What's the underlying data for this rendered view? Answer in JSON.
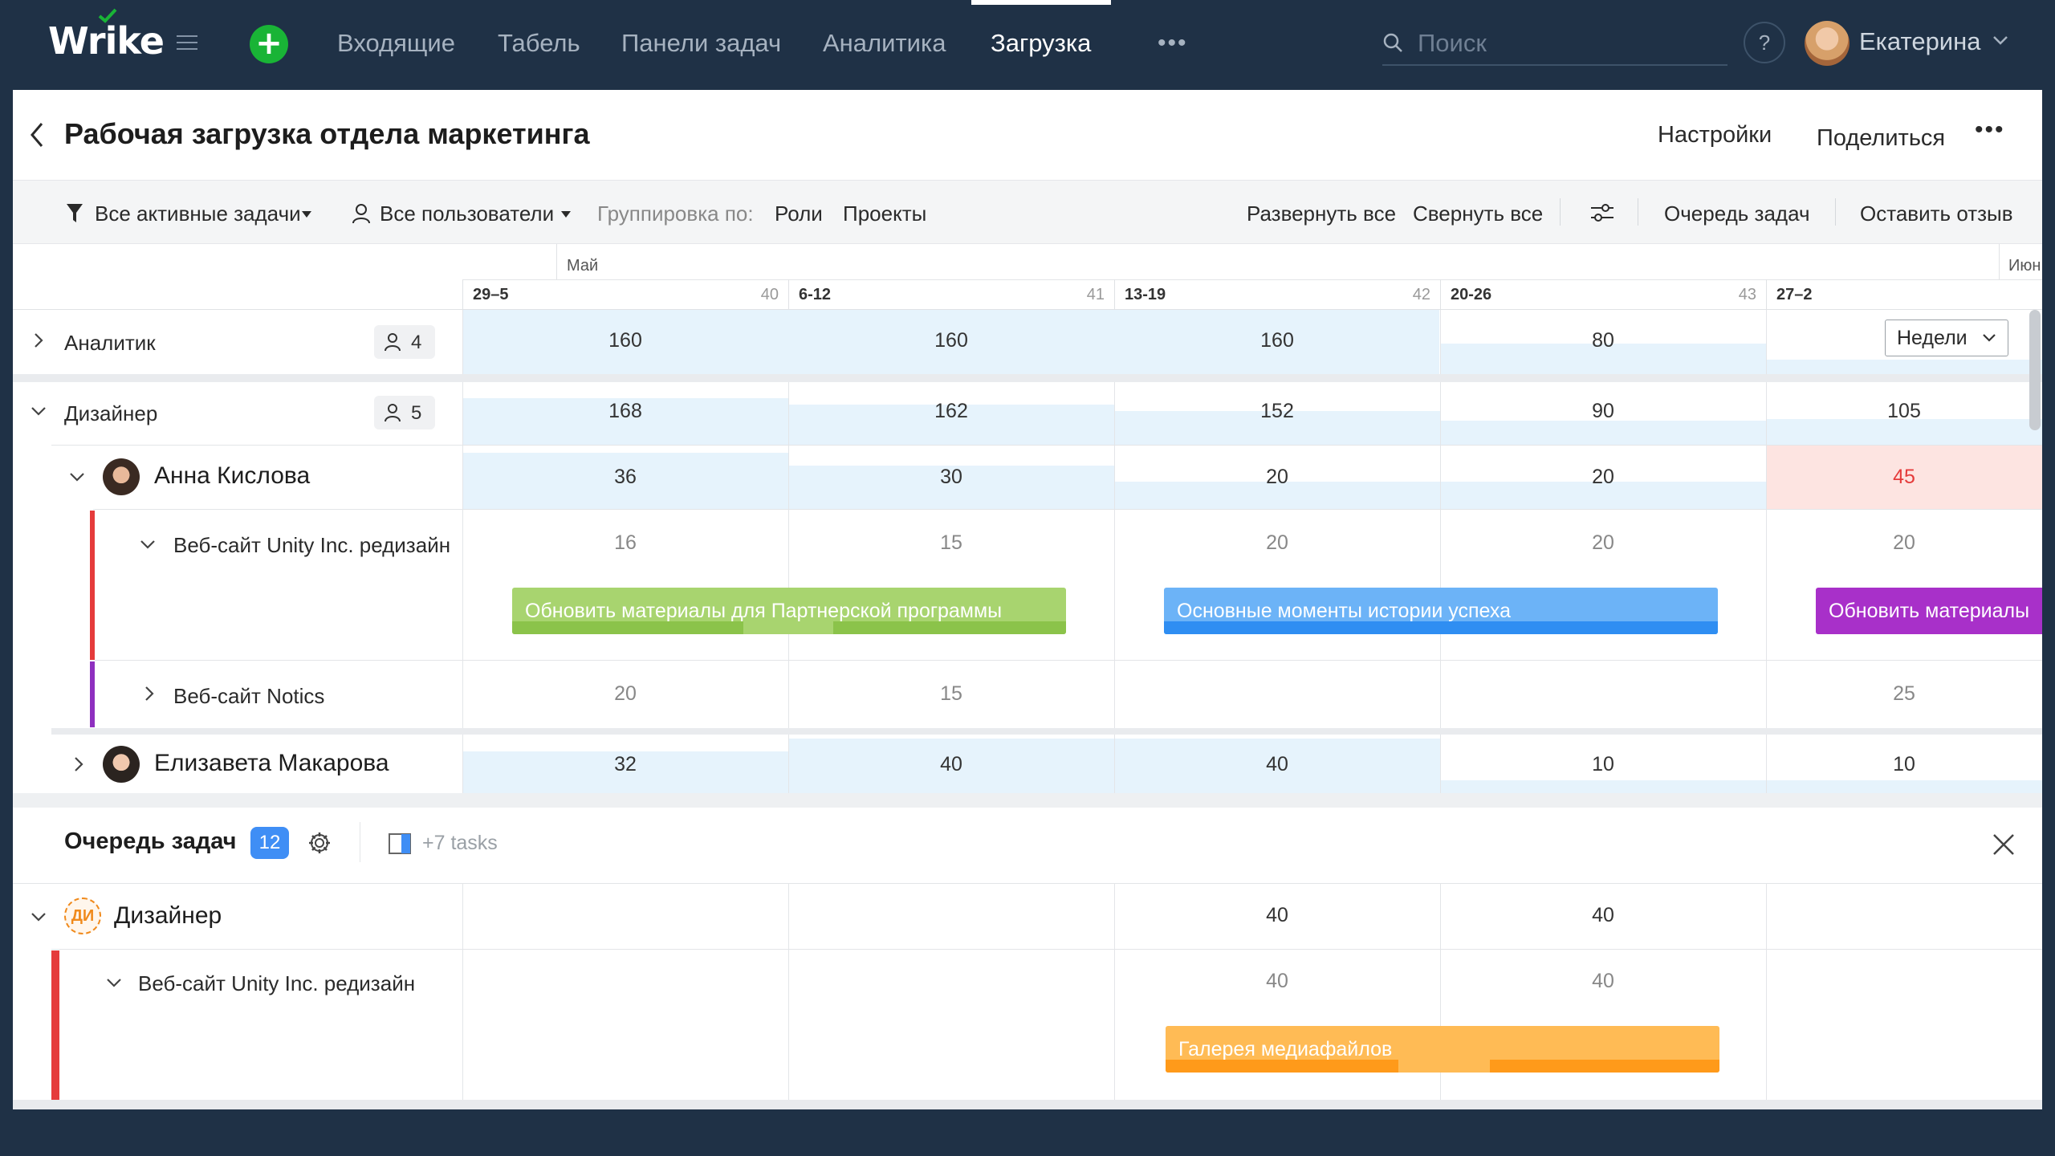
{
  "nav": {
    "logo": "Wrike",
    "items": [
      "Входящие",
      "Табель",
      "Панели задач",
      "Аналитика",
      "Загрузка"
    ],
    "active": "Загрузка",
    "more": "•••",
    "search_placeholder": "Поиск",
    "help": "?",
    "user_name": "Екатерина"
  },
  "header": {
    "title": "Рабочая загрузка отдела маркетинга",
    "settings": "Настройки",
    "share": "Поделиться",
    "more": "•••"
  },
  "toolbar": {
    "filter_tasks": "Все активные задачи",
    "filter_users": "Все пользователи",
    "group_by_label": "Группировка по:",
    "group_roles": "Роли",
    "group_projects": "Проекты",
    "expand_all": "Развернуть все",
    "collapse_all": "Свернуть все",
    "task_queue": "Очередь задач",
    "feedback": "Оставить отзыв"
  },
  "timeline": {
    "months": [
      "Май",
      "Июн"
    ],
    "weeks": [
      {
        "label": "29–5",
        "num": "40"
      },
      {
        "label": "6-12",
        "num": "41"
      },
      {
        "label": "13-19",
        "num": "42"
      },
      {
        "label": "20-26",
        "num": "43"
      },
      {
        "label": "27–2",
        "num": ""
      }
    ],
    "scale_select": "Недели"
  },
  "groups": {
    "analyst": {
      "label": "Аналитик",
      "count": "4",
      "values": [
        "160",
        "160",
        "160",
        "80",
        ""
      ]
    },
    "designer": {
      "label": "Дизайнер",
      "count": "5",
      "values": [
        "168",
        "162",
        "152",
        "90",
        "105"
      ]
    },
    "anna": {
      "name": "Анна Кислова",
      "values": [
        "36",
        "30",
        "20",
        "20",
        "45"
      ]
    },
    "project_unity": {
      "label": "Веб-сайт Unity Inc. редизайн",
      "values": [
        "16",
        "15",
        "20",
        "20",
        "20"
      ],
      "color": "#e53b3b"
    },
    "project_notics": {
      "label": "Веб-сайт Notics",
      "values": [
        "20",
        "15",
        "",
        "",
        "25"
      ],
      "color": "#8e2fbf"
    },
    "elizaveta": {
      "name": "Елизавета Макарова",
      "values": [
        "32",
        "40",
        "40",
        "10",
        "10"
      ]
    }
  },
  "tasks": {
    "t1": {
      "title": "Обновить материалы для Партнерской программы",
      "color": "#8bc34a"
    },
    "t2": {
      "title": "Основные моменты истории успеха",
      "color": "#3d99f5"
    },
    "t3": {
      "title": "Обновить материалы",
      "color": "#a830c9"
    },
    "t4": {
      "title": "Галерея медиафайлов",
      "color": "#ffa32b"
    }
  },
  "queue": {
    "title": "Очередь задач",
    "count": "12",
    "more_tasks": "+7 tasks",
    "group_badge": "ДИ",
    "group_label": "Дизайнер",
    "group_values": [
      "",
      "",
      "40",
      "40",
      ""
    ],
    "project_label": "Веб-сайт Unity Inc. редизайн",
    "project_values": [
      "",
      "",
      "40",
      "40",
      ""
    ]
  },
  "icons": [
    "hamburger-icon",
    "plus-icon",
    "search-icon",
    "help-icon",
    "chevron-down-icon",
    "back-arrow-icon",
    "filter-icon",
    "user-icon",
    "sliders-icon",
    "gear-icon",
    "panel-icon",
    "close-icon"
  ]
}
